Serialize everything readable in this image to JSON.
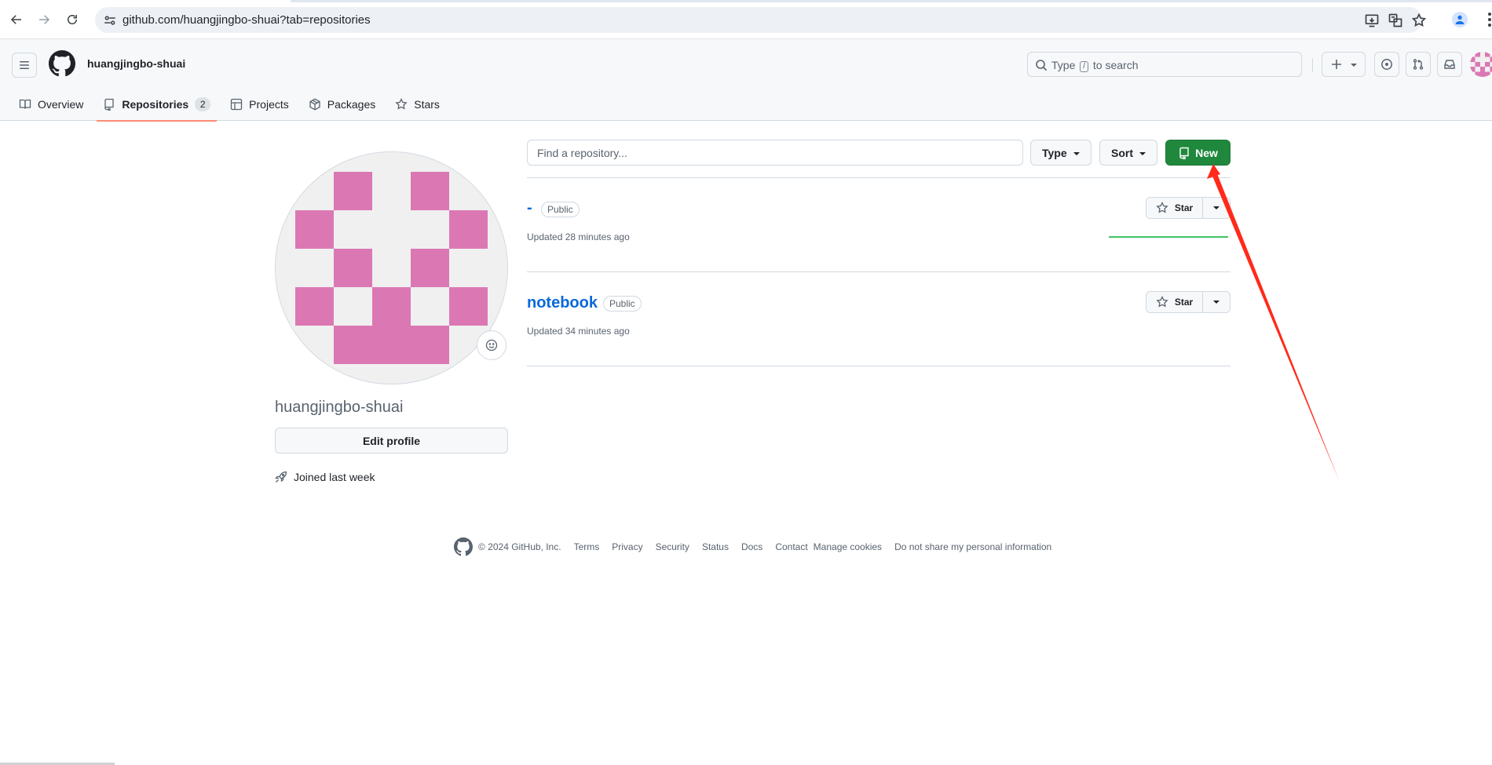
{
  "browser": {
    "url": "github.com/huangjingbo-shuai?tab=repositories"
  },
  "header": {
    "username": "huangjingbo-shuai",
    "search_prefix": "Type",
    "search_slash": "/",
    "search_suffix": "to search"
  },
  "tabs": [
    {
      "label": "Overview",
      "icon": "book-icon"
    },
    {
      "label": "Repositories",
      "icon": "repo-icon",
      "count": "2",
      "active": true
    },
    {
      "label": "Projects",
      "icon": "table-icon"
    },
    {
      "label": "Packages",
      "icon": "package-icon"
    },
    {
      "label": "Stars",
      "icon": "star-icon"
    }
  ],
  "profile": {
    "name": "huangjingbo-shuai",
    "edit_label": "Edit profile",
    "joined": "Joined last week",
    "avatar_color": "#db78b4"
  },
  "repo_controls": {
    "search_placeholder": "Find a repository...",
    "type_label": "Type",
    "sort_label": "Sort",
    "new_label": "New"
  },
  "repos": [
    {
      "name": "-",
      "visibility": "Public",
      "updated": "Updated 28 minutes ago",
      "star_label": "Star"
    },
    {
      "name": "notebook",
      "visibility": "Public",
      "updated": "Updated 34 minutes ago",
      "star_label": "Star"
    }
  ],
  "footer": {
    "copyright": "© 2024 GitHub, Inc.",
    "links": [
      "Terms",
      "Privacy",
      "Security",
      "Status",
      "Docs",
      "Contact",
      "Manage cookies",
      "Do not share my personal information"
    ]
  },
  "colors": {
    "primary_green": "#1f883d",
    "link_blue": "#0969da",
    "annotation_red": "#ff2a1a"
  }
}
